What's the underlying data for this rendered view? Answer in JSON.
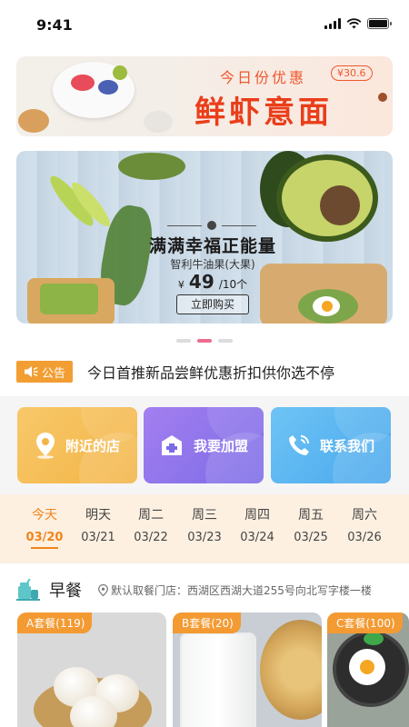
{
  "status": {
    "time": "9:41"
  },
  "banner_top": {
    "subtitle": "今日份优惠",
    "price": "¥30.6",
    "title": "鲜虾意面"
  },
  "banner_main": {
    "title": "满满幸福正能量",
    "subtitle": "智利牛油果(大果)",
    "currency": "¥",
    "price": "49",
    "unit": "/10个",
    "buy_label": "立即购买"
  },
  "carousel": {
    "count": 3,
    "active_index": 1
  },
  "notice": {
    "badge_label": "公告",
    "text": "今日首推新品尝鲜优惠折扣供你选不停"
  },
  "actions": [
    {
      "label": "附近的店",
      "icon": "location-icon",
      "color": "#f3b446"
    },
    {
      "label": "我要加盟",
      "icon": "store-icon",
      "color": "#7b6be6"
    },
    {
      "label": "联系我们",
      "icon": "phone-icon",
      "color": "#49a7ec"
    }
  ],
  "week": {
    "days": [
      {
        "name": "今天",
        "date": "03/20"
      },
      {
        "name": "明天",
        "date": "03/21"
      },
      {
        "name": "周二",
        "date": "03/22"
      },
      {
        "name": "周三",
        "date": "03/23"
      },
      {
        "name": "周四",
        "date": "03/24"
      },
      {
        "name": "周五",
        "date": "03/25"
      },
      {
        "name": "周六",
        "date": "03/26"
      }
    ],
    "active_index": 0,
    "accent": "#f0841c"
  },
  "meal": {
    "title": "早餐",
    "icon": "drink-icon",
    "location": "默认取餐门店：西湖区西湖大道255号向北写字楼一楼",
    "sets": [
      {
        "tag": "A套餐(119)"
      },
      {
        "tag": "B套餐(20)"
      },
      {
        "tag": "C套餐(100)"
      }
    ]
  }
}
